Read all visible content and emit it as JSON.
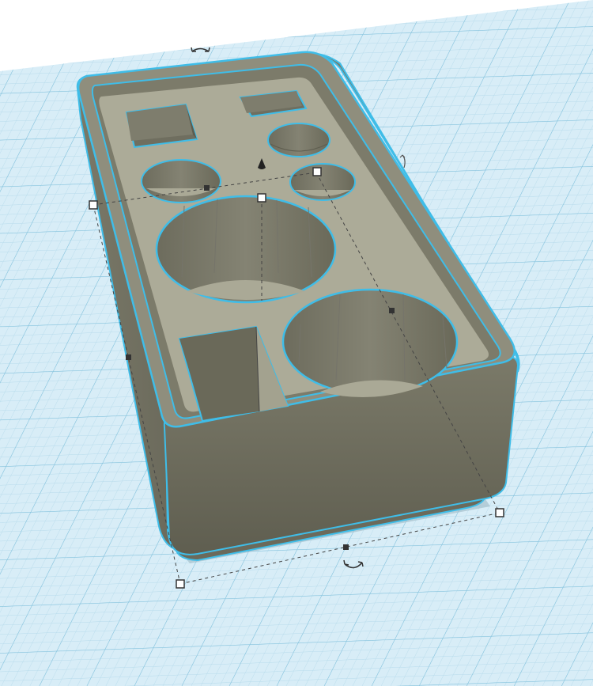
{
  "app": {
    "view": "3d-workplane",
    "colors": {
      "sky": "#ffffff",
      "grid_base": "#d8edf7",
      "grid_minor": "#b3d9ea",
      "grid_major": "#7fc0dc",
      "object_body": "#6e6d5e",
      "object_rim": "#8f8e7d",
      "object_floor": "#acab98",
      "object_wall": "#7c7b6a",
      "selection_outline": "#3fbde8",
      "handle_fill": "#ffffff",
      "handle_stroke": "#333333",
      "bbox_line": "#444444"
    }
  },
  "selected_object": {
    "kind": "box-with-cavities",
    "selected": true,
    "cavities": [
      {
        "name": "square-cavity-top-left",
        "shape": "square"
      },
      {
        "name": "square-cavity-top-right",
        "shape": "square"
      },
      {
        "name": "round-cavity-small-right",
        "shape": "circle"
      },
      {
        "name": "round-cavity-left",
        "shape": "circle"
      },
      {
        "name": "round-cavity-small-lower-right",
        "shape": "circle"
      },
      {
        "name": "round-cavity-large-center",
        "shape": "circle"
      },
      {
        "name": "rect-cavity-bottom-left",
        "shape": "rectangle"
      },
      {
        "name": "round-cavity-large-bottom-right",
        "shape": "circle"
      }
    ],
    "handles": [
      {
        "name": "rotate-handle-top",
        "icon": "rotate-arrow-icon"
      },
      {
        "name": "rotate-handle-right",
        "icon": "rotate-arrow-icon"
      },
      {
        "name": "rotate-handle-bottom",
        "icon": "rotate-arrow-icon"
      },
      {
        "name": "lift-height-cone-handle",
        "icon": "cone-icon"
      },
      {
        "name": "resize-handle-corner",
        "icon": "square-handle-icon"
      }
    ]
  }
}
